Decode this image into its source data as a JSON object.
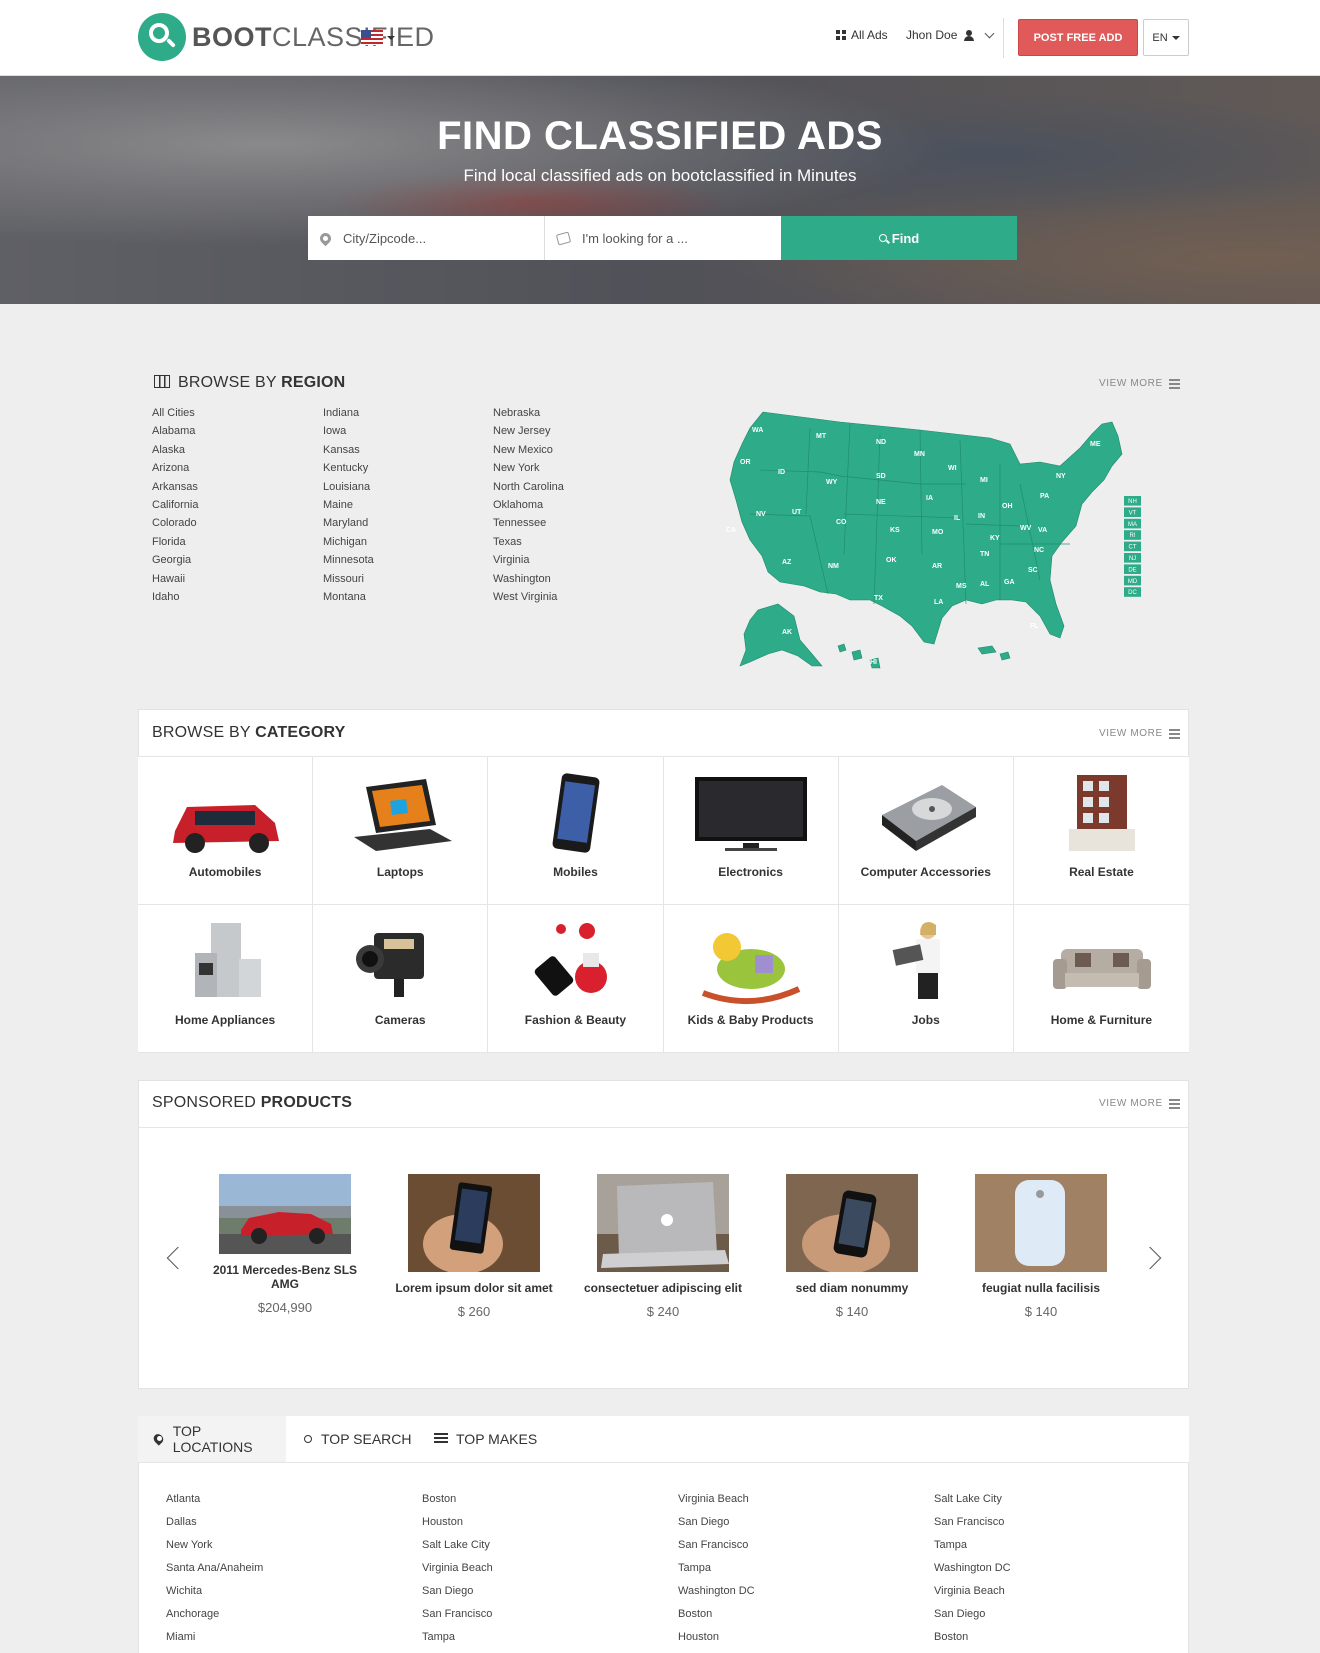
{
  "header": {
    "logo_bold": "BOOT",
    "logo_light": "CLASSIFIED",
    "all_ads": "All Ads",
    "user": "Jhon Doe",
    "post_button": "POST FREE ADD",
    "language": "EN"
  },
  "hero": {
    "title": "FIND CLASSIFIED ADS",
    "subtitle": "Find local classified ads on bootclassified in Minutes",
    "location_placeholder": "City/Zipcode...",
    "keyword_placeholder": "I'm looking for a ...",
    "find_button": "Find"
  },
  "region": {
    "title_light": "BROWSE BY ",
    "title_bold": "REGION",
    "view_more": "VIEW MORE",
    "columns": [
      [
        "All Cities",
        "Alabama",
        "Alaska",
        "Arizona",
        "Arkansas",
        "California",
        "Colorado",
        "Florida",
        "Georgia",
        "Hawaii",
        "Idaho"
      ],
      [
        "Indiana",
        "Iowa",
        "Kansas",
        "Kentucky",
        "Louisiana",
        "Maine",
        "Maryland",
        "Michigan",
        "Minnesota",
        "Missouri",
        "Montana"
      ],
      [
        "Nebraska",
        "New Jersey",
        "New Mexico",
        "New York",
        "North Carolina",
        "Oklahoma",
        "Tennessee",
        "Texas",
        "Virginia",
        "Washington",
        "West Virginia"
      ]
    ],
    "map_labels": [
      "WA",
      "OR",
      "CA",
      "ID",
      "NV",
      "MT",
      "WY",
      "UT",
      "AZ",
      "CO",
      "NM",
      "ND",
      "SD",
      "NE",
      "KS",
      "OK",
      "TX",
      "MN",
      "IA",
      "MO",
      "AR",
      "LA",
      "WI",
      "IL",
      "MS",
      "MI",
      "IN",
      "KY",
      "TN",
      "AL",
      "OH",
      "GA",
      "FL",
      "SC",
      "NC",
      "WV",
      "VA",
      "PA",
      "NY",
      "ME",
      "AK",
      "HI"
    ],
    "map_boxes": [
      "NH",
      "VT",
      "MA",
      "RI",
      "CT",
      "NJ",
      "DE",
      "MD",
      "DC"
    ],
    "map_color": "#2eab88"
  },
  "category": {
    "title_light": "BROWSE BY ",
    "title_bold": "CATEGORY",
    "view_more": "VIEW MORE",
    "items": [
      {
        "label": "Automobiles",
        "icon": "car-icon"
      },
      {
        "label": "Laptops",
        "icon": "laptop-icon"
      },
      {
        "label": "Mobiles",
        "icon": "phone-icon"
      },
      {
        "label": "Electronics",
        "icon": "tv-icon"
      },
      {
        "label": "Computer Accessories",
        "icon": "hard-drive-icon"
      },
      {
        "label": "Real Estate",
        "icon": "building-icon"
      },
      {
        "label": "Home Appliances",
        "icon": "fridge-icon"
      },
      {
        "label": "Cameras",
        "icon": "camera-icon"
      },
      {
        "label": "Fashion & Beauty",
        "icon": "nail-polish-icon"
      },
      {
        "label": "Kids & Baby Products",
        "icon": "rocking-toy-icon"
      },
      {
        "label": "Jobs",
        "icon": "businesswoman-icon"
      },
      {
        "label": "Home & Furniture",
        "icon": "sofa-icon"
      }
    ]
  },
  "sponsored": {
    "title_light": "SPONSORED ",
    "title_bold": "PRODUCTS",
    "view_more": "VIEW MORE",
    "products": [
      {
        "name": "2011 Mercedes-Benz SLS AMG",
        "price": "$204,990"
      },
      {
        "name": "Lorem ipsum dolor sit amet",
        "price": "$ 260"
      },
      {
        "name": "consectetuer adipiscing elit",
        "price": "$ 240"
      },
      {
        "name": "sed diam nonummy",
        "price": "$ 140"
      },
      {
        "name": "feugiat nulla facilisis",
        "price": "$ 140"
      }
    ]
  },
  "top": {
    "tabs": [
      "TOP LOCATIONS",
      "TOP SEARCH",
      "TOP MAKES"
    ],
    "columns": [
      [
        "Atlanta",
        "Dallas",
        "New York",
        "Santa Ana/Anaheim",
        "Wichita",
        "Anchorage",
        "Miami"
      ],
      [
        "Boston",
        "Houston",
        "Salt Lake City",
        "Virginia Beach",
        "San Diego",
        "San Francisco",
        "Tampa"
      ],
      [
        "Virginia Beach",
        "San Diego",
        "San Francisco",
        "Tampa",
        "Washington DC",
        "Boston",
        "Houston"
      ],
      [
        "Salt Lake City",
        "San Francisco",
        "Tampa",
        "Washington DC",
        "Virginia Beach",
        "San Diego",
        "Boston"
      ]
    ]
  }
}
